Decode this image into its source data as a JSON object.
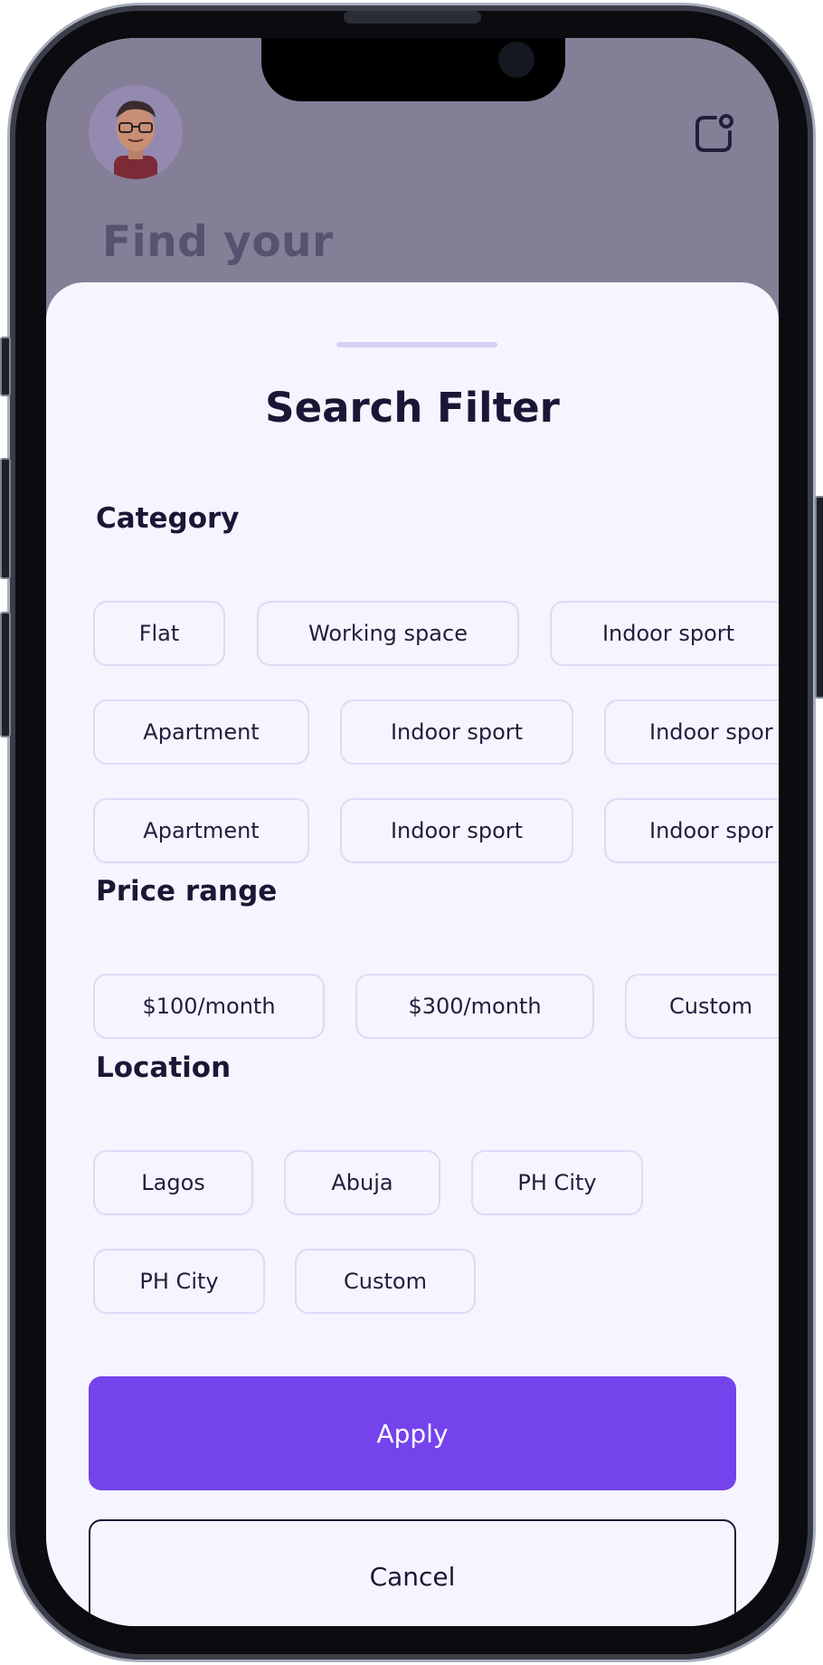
{
  "header": {
    "title_partial": "Find your"
  },
  "sheet": {
    "title": "Search Filter"
  },
  "category": {
    "label": "Category",
    "rows": [
      [
        "Flat",
        "Working space",
        "Indoor sport"
      ],
      [
        "Apartment",
        "Indoor sport",
        "Indoor spor"
      ],
      [
        "Apartment",
        "Indoor sport",
        "Indoor spor"
      ]
    ]
  },
  "price": {
    "label": "Price range",
    "options": [
      "$100/month",
      "$300/month",
      "Custom"
    ]
  },
  "location": {
    "label": "Location",
    "rows": [
      [
        "Lagos",
        "Abuja",
        "PH City"
      ],
      [
        "PH City",
        "Custom"
      ]
    ]
  },
  "actions": {
    "apply": "Apply",
    "cancel": "Cancel"
  },
  "icons": {
    "avatar": "avatar",
    "notification": "notification-icon"
  },
  "colors": {
    "accent": "#7443ec",
    "header_bg": "#847f96",
    "sheet_bg": "#f6f4fe",
    "chip_border": "#dedaf6",
    "text": "#1c1636"
  }
}
